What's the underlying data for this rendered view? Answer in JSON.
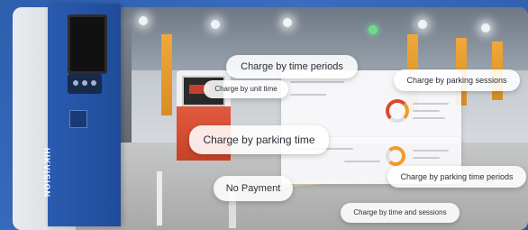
{
  "brand_label": "HIKVISION",
  "charge_options": {
    "time_periods": "Charge by time periods",
    "unit_time": "Charge by unit time",
    "parking_sessions": "Charge by parking sessions",
    "parking_time": "Charge by parking time",
    "no_payment": "No Payment",
    "parking_time_periods": "Charge by parking time periods",
    "time_and_sessions": "Charge by time and sessions"
  },
  "colors": {
    "background_blue": "#2f5fa8",
    "kiosk_blue": "#2a5bb0",
    "donut_red": "#e0452f",
    "donut_orange": "#f29b2b",
    "pillar_orange": "#f0a83a"
  }
}
